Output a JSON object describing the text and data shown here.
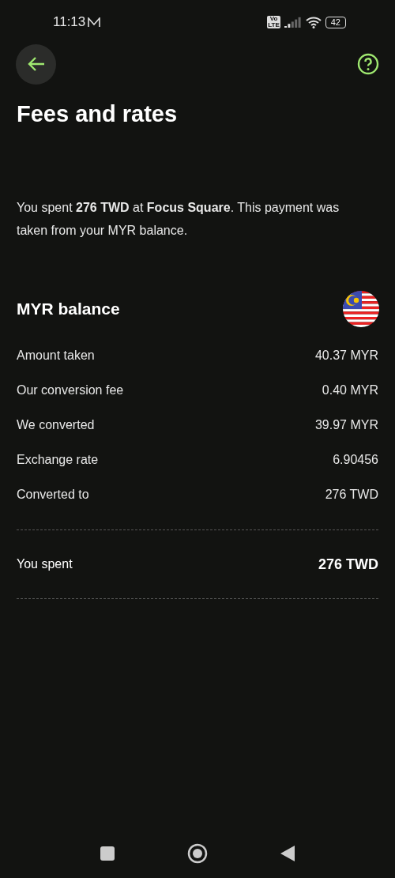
{
  "status_bar": {
    "time": "11:13",
    "volte": [
      "Vo",
      "LTE"
    ],
    "battery": "42"
  },
  "title": "Fees and rates",
  "summary": "You spent **276 TWD** at **Focus Square**. This payment was taken from your MYR balance.",
  "balance": {
    "title": "MYR balance",
    "rows": [
      {
        "label": "Amount taken",
        "value": "40.37 MYR"
      },
      {
        "label": "Our conversion fee",
        "value": "0.40 MYR"
      },
      {
        "label": "We converted",
        "value": "39.97 MYR"
      },
      {
        "label": "Exchange rate",
        "value": "6.90456"
      },
      {
        "label": "Converted to",
        "value": "276 TWD"
      }
    ],
    "total": {
      "label": "You spent",
      "value": "276 TWD"
    }
  }
}
